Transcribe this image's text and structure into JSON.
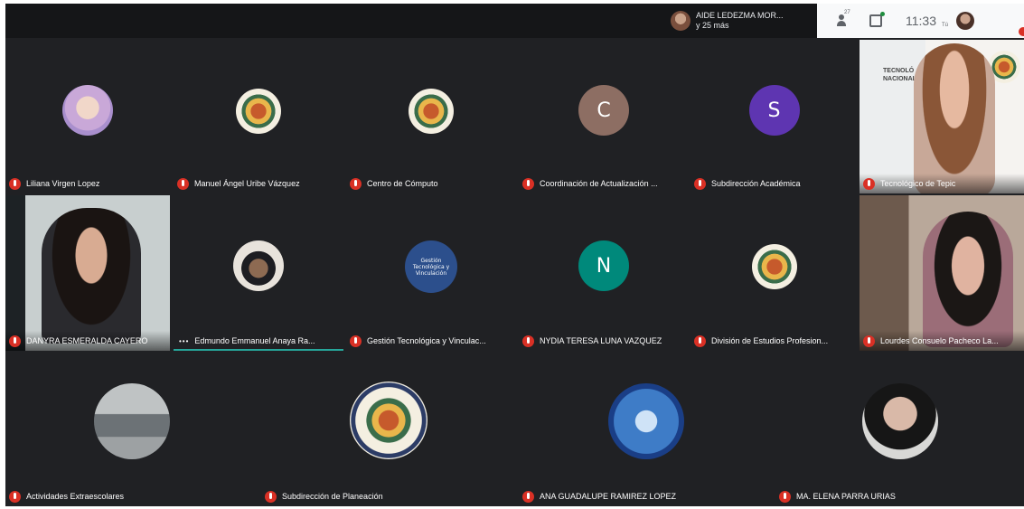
{
  "topbar": {
    "presenter_line1": "AIDE LEDEZMA MOR...",
    "presenter_line2": "y 25 más",
    "people_count": "27",
    "clock": "11:33",
    "self_label": "Tú"
  },
  "tiles": {
    "liliana": {
      "name": "Liliana Virgen Lopez"
    },
    "manuel": {
      "name": "Manuel Ángel Uribe Vázquez"
    },
    "centro": {
      "name": "Centro de Cómputo"
    },
    "coordinacion": {
      "name": "Coordinación de Actualización ...",
      "initial": "C"
    },
    "subdireccion_academica": {
      "name": "Subdirección Académica",
      "initial": "S"
    },
    "tecnologico": {
      "name": "Tecnológico de Tepic",
      "watermark": "TECNOLÓ\nNACIONAL DE"
    },
    "danyra": {
      "name": "DANYRA ESMERALDA CAYERO"
    },
    "edmundo": {
      "name": "Edmundo Emmanuel Anaya Ra...",
      "dots": "•••"
    },
    "gestion": {
      "name": "Gestión Tecnológica y Vinculac...",
      "avatar_text": "Gestión Tecnológica y Vinculación"
    },
    "nydia": {
      "name": "NYDIA TERESA LUNA VAZQUEZ",
      "initial": "N"
    },
    "division": {
      "name": "División de Estudios Profesion..."
    },
    "lourdes": {
      "name": "Lourdes Consuelo Pacheco La..."
    },
    "actividades": {
      "name": "Actividades Extraescolares"
    },
    "planeacion": {
      "name": "Subdirección de Planeación"
    },
    "ana": {
      "name": "ANA GUADALUPE RAMIREZ LOPEZ"
    },
    "elena": {
      "name": "MA. ELENA PARRA URIAS"
    }
  },
  "colors": {
    "background": "#202124",
    "mic_muted": "#d93025",
    "avatar_C": "#8d6e63",
    "avatar_S": "#5e35b1",
    "avatar_N": "#00897b",
    "speaking": "#26a69a"
  }
}
